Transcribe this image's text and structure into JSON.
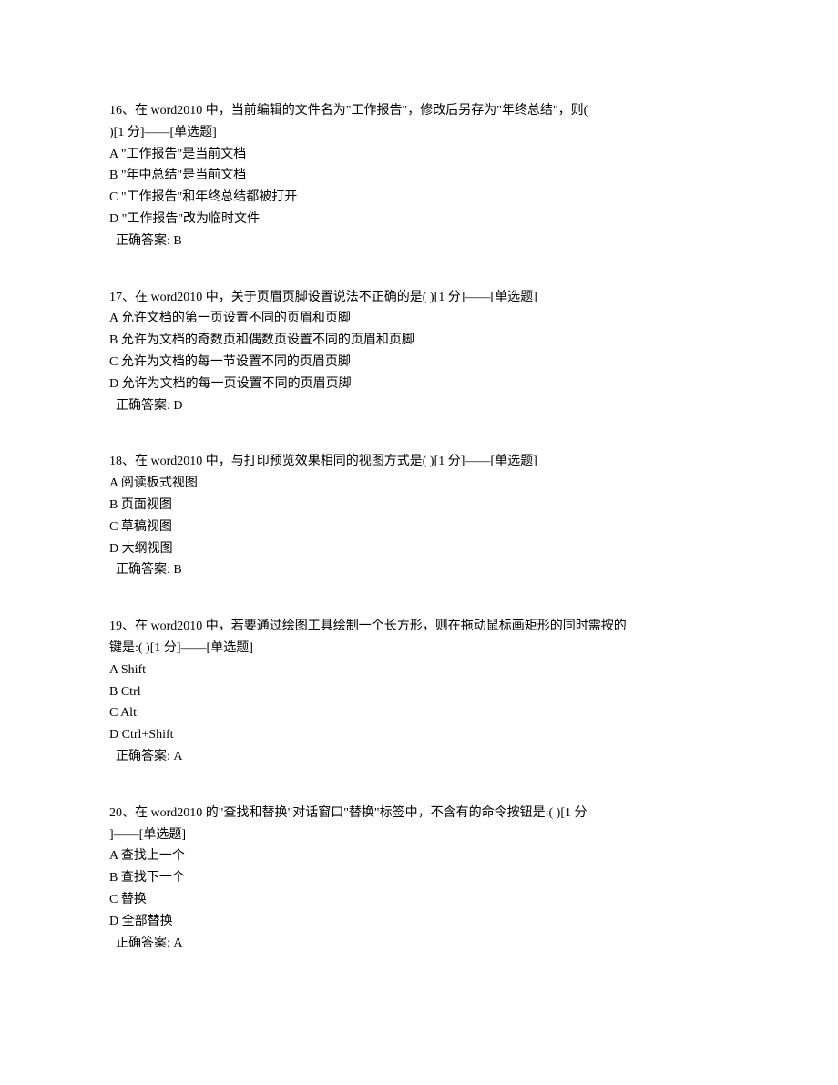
{
  "questions": [
    {
      "num": "16",
      "stem_line1": "16、在 word2010 中，当前编辑的文件名为\"工作报告\"，修改后另存为\"年终总结\"，则(",
      "stem_line2": ")[1 分]——[单选题]",
      "options": {
        "A": "A \"工作报告\"是当前文档",
        "B": "B \"年中总结\"是当前文档",
        "C": "C \"工作报告\"和年终总结都被打开",
        "D": "D \"工作报告\"改为临时文件"
      },
      "answer": " 正确答案: B"
    },
    {
      "num": "17",
      "stem_line1": "17、在 word2010 中，关于页眉页脚设置说法不正确的是( )[1 分]——[单选题]",
      "stem_line2": "",
      "options": {
        "A": "A 允许文档的第一页设置不同的页眉和页脚",
        "B": "B 允许为文档的奇数页和偶数页设置不同的页眉和页脚",
        "C": "C 允许为文档的每一节设置不同的页眉页脚",
        "D": "D 允许为文档的每一页设置不同的页眉页脚"
      },
      "answer": " 正确答案: D"
    },
    {
      "num": "18",
      "stem_line1": "18、在 word2010 中，与打印预览效果相同的视图方式是( )[1 分]——[单选题]",
      "stem_line2": "",
      "options": {
        "A": "A 阅读板式视图",
        "B": "B 页面视图",
        "C": "C 草稿视图",
        "D": "D 大纲视图"
      },
      "answer": " 正确答案: B"
    },
    {
      "num": "19",
      "stem_line1": "19、在 word2010 中，若要通过绘图工具绘制一个长方形，则在拖动鼠标画矩形的同时需按的",
      "stem_line2": "键是:( )[1 分]——[单选题]",
      "options": {
        "A": "A Shift",
        "B": "B Ctrl",
        "C": "C Alt",
        "D": "D Ctrl+Shift"
      },
      "answer": " 正确答案: A"
    },
    {
      "num": "20",
      "stem_line1": "20、在 word2010 的\"查找和替换\"对话窗口\"替换\"标签中，不含有的命令按钮是:( )[1 分",
      "stem_line2": "]——[单选题]",
      "options": {
        "A": "A 查找上一个",
        "B": "B 查找下一个",
        "C": "C 替换",
        "D": "D 全部替换"
      },
      "answer": " 正确答案: A"
    }
  ]
}
